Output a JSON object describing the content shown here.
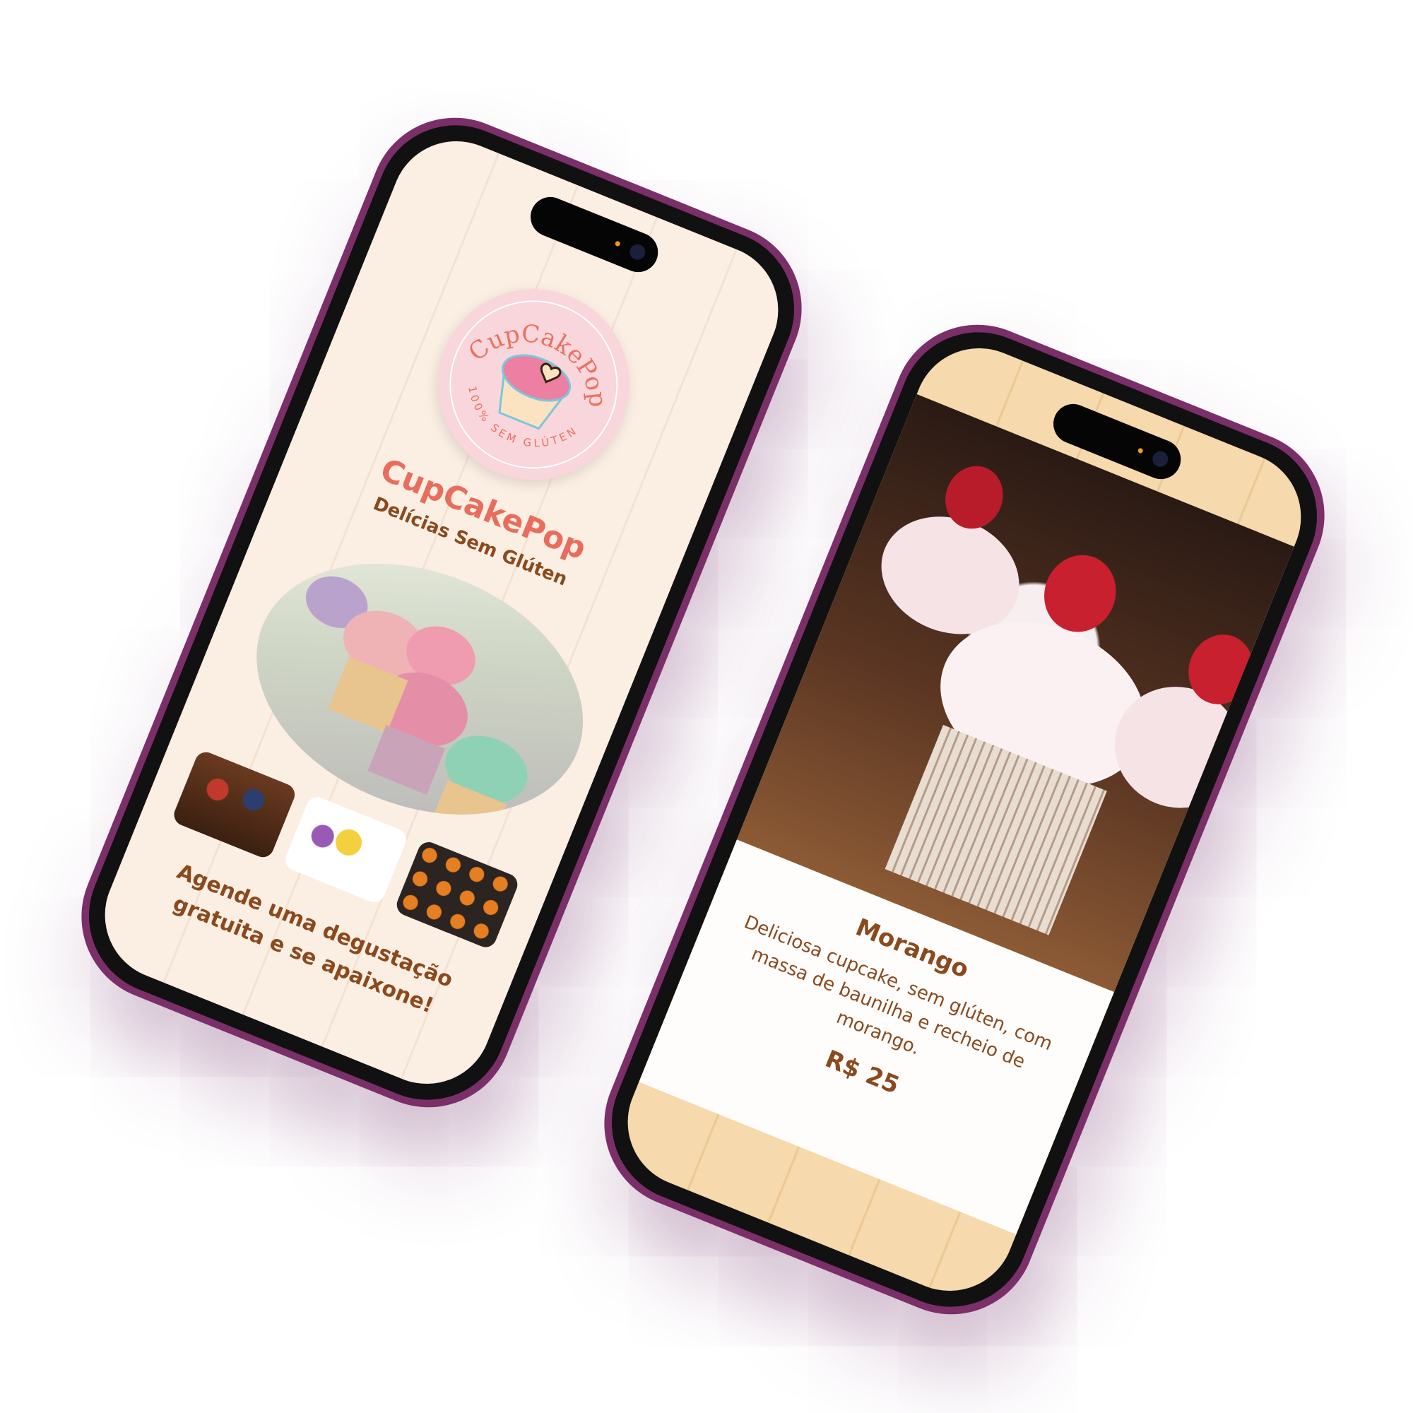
{
  "left_screen": {
    "logo": {
      "text_top": "CupCakePop",
      "text_bottom": "100% SEM GLÚTEN"
    },
    "title": "CupCakePop",
    "subtitle": "Delícias Sem Glúten",
    "cta": "Agende uma degustação gratuita e se apaixone!"
  },
  "right_screen": {
    "product": {
      "name": "Morango",
      "description": "Deliciosa cupcake, sem glúten, com massa de baunilha e recheio de morango.",
      "price": "R$ 25"
    }
  },
  "colors": {
    "brand": "#e96d5c",
    "text": "#8a4a1e",
    "frame": "#7a2f68"
  }
}
